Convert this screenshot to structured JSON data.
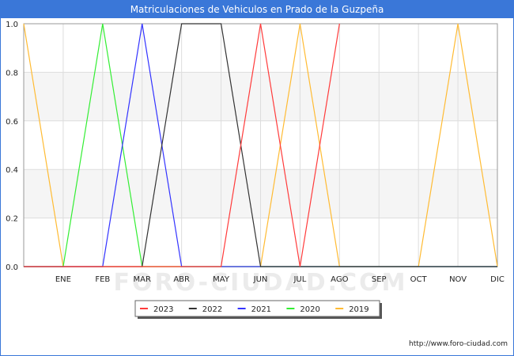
{
  "title": "Matriculaciones de Vehiculos en Prado de la Guzpeña",
  "source": "http://www.foro-ciudad.com",
  "watermark": "FORO-CIUDAD.COM",
  "chart_data": {
    "type": "line",
    "title": "Matriculaciones de Vehiculos en Prado de la Guzpeña",
    "xlabel": "",
    "ylabel": "",
    "x": [
      "",
      "ENE",
      "FEB",
      "MAR",
      "ABR",
      "MAY",
      "JUN",
      "JUL",
      "AGO",
      "SEP",
      "OCT",
      "NOV",
      "DIC"
    ],
    "ylim": [
      0,
      1
    ],
    "yticks": [
      "0.0",
      "0.2",
      "0.4",
      "0.6",
      "0.8",
      "1.0"
    ],
    "grid": true,
    "legend_position": "bottom-center",
    "series": [
      {
        "name": "2023",
        "color": "#ff3b3b",
        "values": [
          0,
          0,
          0,
          0,
          0,
          0,
          1,
          0,
          1,
          null,
          null,
          null,
          null
        ]
      },
      {
        "name": "2022",
        "color": "#333333",
        "values": [
          0,
          0,
          0,
          0,
          1,
          1,
          0,
          0,
          0,
          0,
          0,
          0,
          0
        ]
      },
      {
        "name": "2021",
        "color": "#3333ff",
        "values": [
          0,
          0,
          0,
          1,
          0,
          0,
          0,
          0,
          0,
          0,
          0,
          0,
          0
        ]
      },
      {
        "name": "2020",
        "color": "#33ee33",
        "values": [
          0,
          0,
          1,
          0,
          0,
          0,
          0,
          0,
          0,
          0,
          0,
          0,
          0
        ]
      },
      {
        "name": "2019",
        "color": "#ffbb33",
        "values": [
          1,
          0,
          0,
          0,
          0,
          0,
          0,
          1,
          0,
          0,
          0,
          1,
          0
        ]
      }
    ]
  }
}
